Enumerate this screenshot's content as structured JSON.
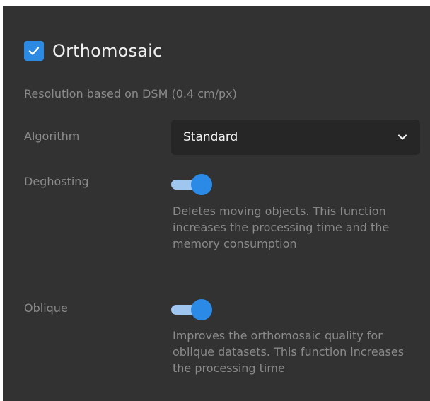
{
  "orthomosaic": {
    "checked": true,
    "title": "Orthomosaic",
    "check_icon": "checkmark-icon"
  },
  "resolution_text": "Resolution based on DSM (0.4 cm/px)",
  "algorithm": {
    "label": "Algorithm",
    "selected": "Standard",
    "dropdown_icon": "chevron-down-icon"
  },
  "deghosting": {
    "label": "Deghosting",
    "enabled": true,
    "description": "Deletes moving objects. This function increases the processing time and the memory consumption"
  },
  "oblique": {
    "label": "Oblique",
    "enabled": true,
    "description": "Improves the orthomosaic quality for oblique datasets. This function increases the processing time"
  },
  "colors": {
    "panel_background": "#323232",
    "accent": "#2b8ae6",
    "toggle_track": "#9fc6ef",
    "muted_text": "#8a8a8a",
    "select_background": "#262626"
  }
}
